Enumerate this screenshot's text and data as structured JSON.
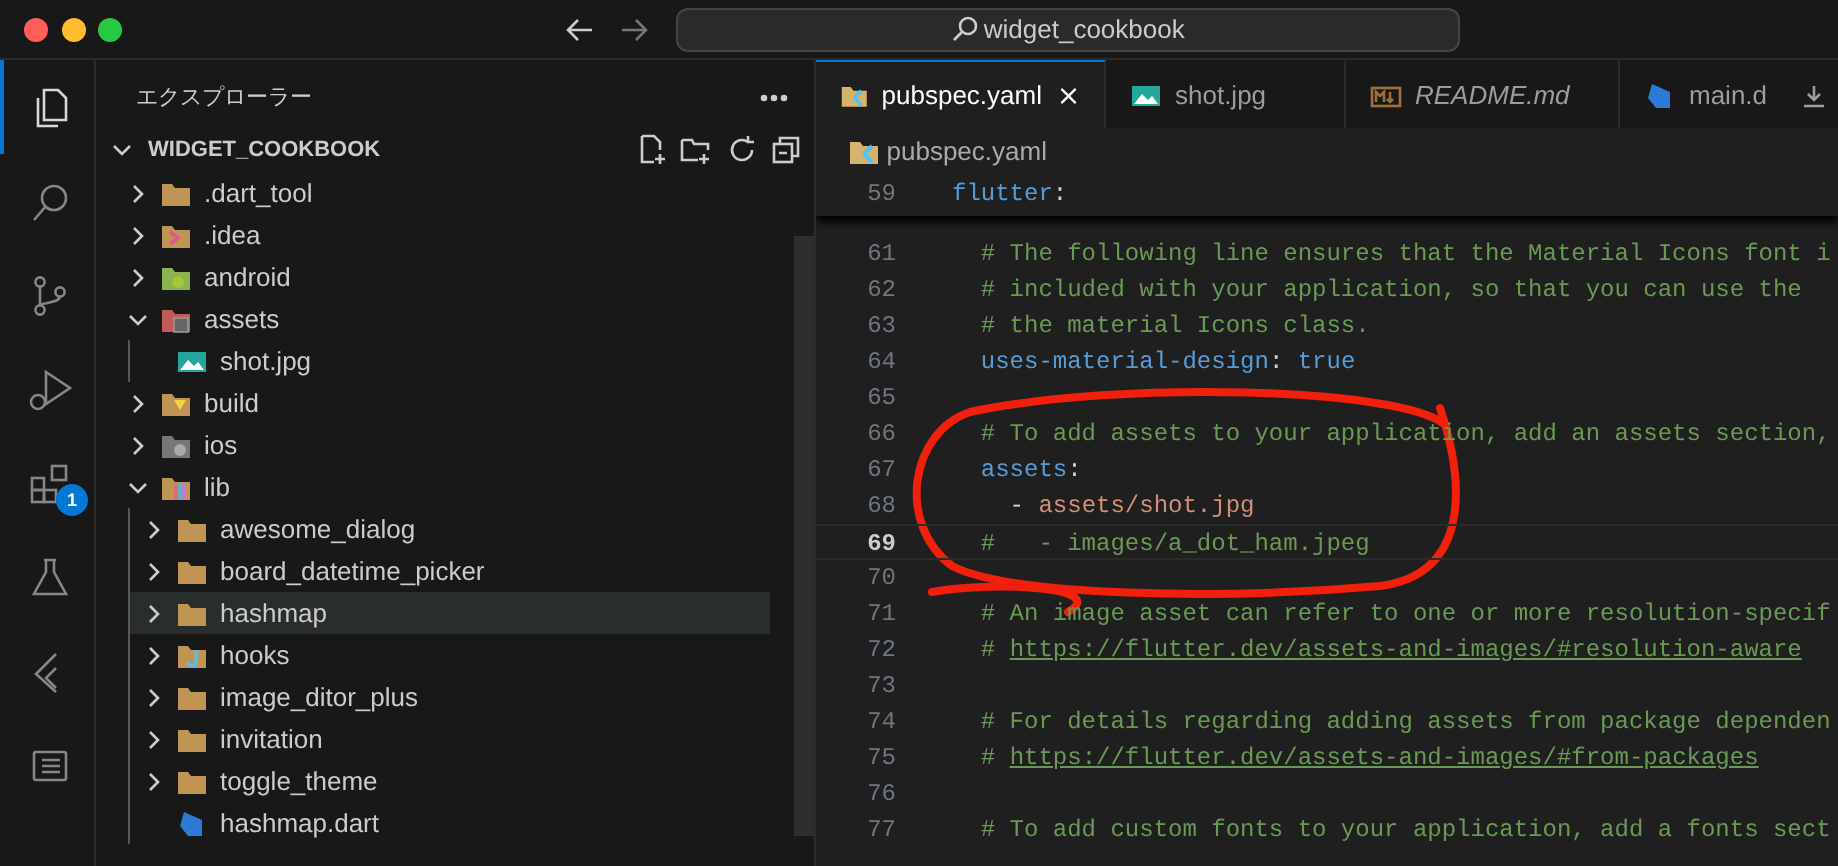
{
  "window": {
    "title": "widget_cookbook"
  },
  "activity_bar": {
    "items": [
      {
        "kind": "files",
        "selected": true
      },
      {
        "kind": "search",
        "selected": false
      },
      {
        "kind": "scm",
        "selected": false
      },
      {
        "kind": "debug",
        "selected": false
      },
      {
        "kind": "extensions",
        "selected": false,
        "badge": "1"
      },
      {
        "kind": "testing",
        "selected": false
      },
      {
        "kind": "flutter",
        "selected": false
      },
      {
        "kind": "outline",
        "selected": false
      }
    ]
  },
  "sidebar": {
    "title": "エクスプローラー",
    "project": {
      "name": "WIDGET_COOKBOOK",
      "expanded": true
    },
    "items": [
      {
        "label": ".dart_tool",
        "kind": "folder",
        "expanded": false,
        "selected": false
      },
      {
        "label": ".idea",
        "kind": "folder-idea",
        "expanded": false,
        "selected": false
      },
      {
        "label": "android",
        "kind": "folder-android",
        "expanded": false,
        "selected": false
      },
      {
        "label": "assets",
        "kind": "folder-assets",
        "expanded": true,
        "selected": false,
        "children": [
          {
            "label": "shot.jpg",
            "kind": "image",
            "selected": false
          }
        ]
      },
      {
        "label": "build",
        "kind": "folder-build",
        "expanded": false,
        "selected": false
      },
      {
        "label": "ios",
        "kind": "folder-ios",
        "expanded": false,
        "selected": false
      },
      {
        "label": "lib",
        "kind": "folder-lib",
        "expanded": true,
        "selected": false,
        "children": [
          {
            "label": "awesome_dialog",
            "kind": "folder",
            "expanded": false,
            "selected": false
          },
          {
            "label": "board_datetime_picker",
            "kind": "folder",
            "expanded": false,
            "selected": false
          },
          {
            "label": "hashmap",
            "kind": "folder",
            "expanded": false,
            "selected": true
          },
          {
            "label": "hooks",
            "kind": "folder-hooks",
            "expanded": false,
            "selected": false
          },
          {
            "label": "image_ditor_plus",
            "kind": "folder",
            "expanded": false,
            "selected": false
          },
          {
            "label": "invitation",
            "kind": "folder",
            "expanded": false,
            "selected": false
          },
          {
            "label": "toggle_theme",
            "kind": "folder",
            "expanded": false,
            "selected": false
          },
          {
            "label": "hashmap.dart",
            "kind": "dart",
            "selected": false
          }
        ]
      }
    ]
  },
  "tabs": [
    {
      "label": "pubspec.yaml",
      "kind": "yaml",
      "selected": true,
      "preview": false
    },
    {
      "label": "shot.jpg",
      "kind": "image",
      "selected": false,
      "preview": false
    },
    {
      "label": "README.md",
      "kind": "markdown",
      "selected": false,
      "preview": true
    },
    {
      "label": "main.d",
      "kind": "dart",
      "selected": false,
      "preview": false
    }
  ],
  "breadcrumb": "pubspec.yaml",
  "sticky_line": {
    "number": "59",
    "segments": [
      {
        "kind": "key",
        "text": "flutter"
      },
      {
        "kind": "punct",
        "text": ":"
      }
    ]
  },
  "lines": [
    {
      "number": "61",
      "current": false,
      "segments": [
        {
          "kind": "comment",
          "text": "  # The following line ensures that the Material Icons font i"
        }
      ]
    },
    {
      "number": "62",
      "current": false,
      "segments": [
        {
          "kind": "comment",
          "text": "  # included with your application, so that you can use the"
        }
      ]
    },
    {
      "number": "63",
      "current": false,
      "segments": [
        {
          "kind": "comment",
          "text": "  # the material Icons class."
        }
      ]
    },
    {
      "number": "64",
      "current": false,
      "segments": [
        {
          "kind": "key",
          "text": "  uses-material-design"
        },
        {
          "kind": "punct",
          "text": ": "
        },
        {
          "kind": "bool",
          "text": "true"
        }
      ]
    },
    {
      "number": "65",
      "current": false
    },
    {
      "number": "66",
      "current": false,
      "segments": [
        {
          "kind": "comment",
          "text": "  # To add assets to your application, add an assets section,"
        }
      ]
    },
    {
      "number": "67",
      "current": false,
      "segments": [
        {
          "kind": "key",
          "text": "  assets"
        },
        {
          "kind": "punct",
          "text": ":"
        }
      ]
    },
    {
      "number": "68",
      "current": false,
      "segments": [
        {
          "kind": "punct",
          "text": "    - "
        },
        {
          "kind": "string",
          "text": "assets/shot.jpg"
        }
      ]
    },
    {
      "number": "69",
      "current": true,
      "segments": [
        {
          "kind": "comment",
          "text": "  #   - images/a_dot_ham.jpeg"
        }
      ]
    },
    {
      "number": "70",
      "current": false
    },
    {
      "number": "71",
      "current": false,
      "segments": [
        {
          "kind": "comment",
          "text": "  # An image asset can refer to one or more resolution-specif"
        }
      ]
    },
    {
      "number": "72",
      "current": false,
      "segments": [
        {
          "kind": "comment",
          "text": "  # "
        },
        {
          "kind": "link",
          "text": "https://flutter.dev/assets-and-images/#resolution-aware"
        }
      ]
    },
    {
      "number": "73",
      "current": false
    },
    {
      "number": "74",
      "current": false,
      "segments": [
        {
          "kind": "comment",
          "text": "  # For details regarding adding assets from package dependen"
        }
      ]
    },
    {
      "number": "75",
      "current": false,
      "segments": [
        {
          "kind": "comment",
          "text": "  # "
        },
        {
          "kind": "link",
          "text": "https://flutter.dev/assets-and-images/#from-packages"
        }
      ]
    },
    {
      "number": "76",
      "current": false
    },
    {
      "number": "77",
      "current": false,
      "segments": [
        {
          "kind": "comment",
          "text": "  # To add custom fonts to your application, add a fonts sect"
        }
      ]
    }
  ]
}
